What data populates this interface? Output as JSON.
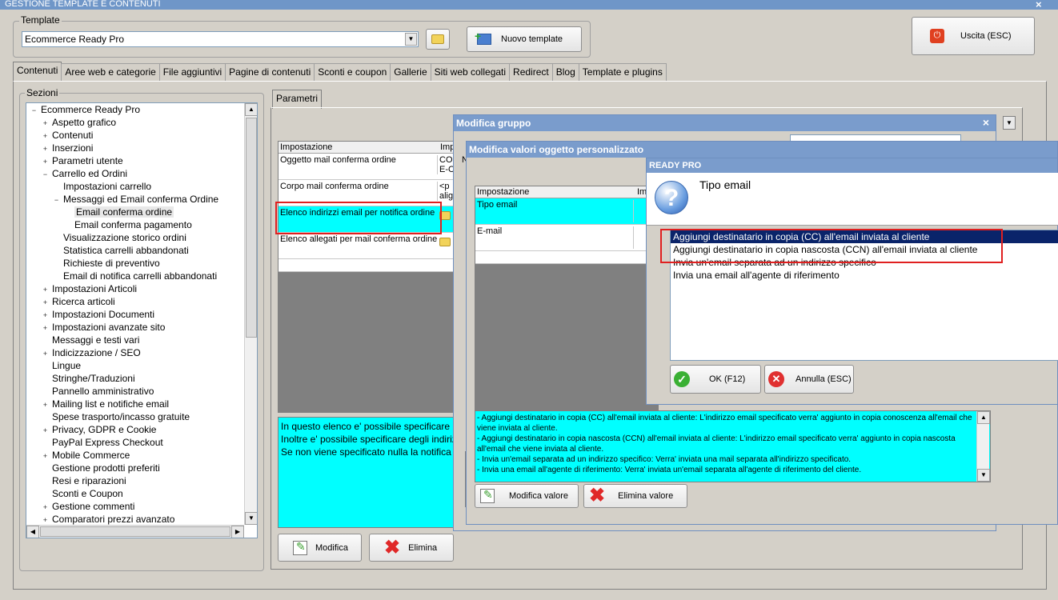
{
  "window": {
    "title": "GESTIONE TEMPLATE E CONTENUTI",
    "close": "×"
  },
  "template_group": {
    "label": "Template",
    "selected": "Ecommerce Ready Pro",
    "new_button": "Nuovo template"
  },
  "exit_button": "Uscita (ESC)",
  "tabs": [
    {
      "label": "Contenuti"
    },
    {
      "label": "Aree web e categorie"
    },
    {
      "label": "File aggiuntivi"
    },
    {
      "label": "Pagine di contenuti"
    },
    {
      "label": "Sconti e coupon"
    },
    {
      "label": "Gallerie"
    },
    {
      "label": "Siti web collegati"
    },
    {
      "label": "Redirect"
    },
    {
      "label": "Blog"
    },
    {
      "label": "Template e plugins"
    }
  ],
  "sections": {
    "label": "Sezioni",
    "tree": [
      {
        "label": "Ecommerce Ready Pro",
        "level": 0,
        "exp": "−"
      },
      {
        "label": "Aspetto grafico",
        "level": 1,
        "exp": "+"
      },
      {
        "label": "Contenuti",
        "level": 1,
        "exp": "+"
      },
      {
        "label": "Inserzioni",
        "level": 1,
        "exp": "+"
      },
      {
        "label": "Parametri utente",
        "level": 1,
        "exp": "+"
      },
      {
        "label": "Carrello ed Ordini",
        "level": 1,
        "exp": "−"
      },
      {
        "label": "Impostazioni carrello",
        "level": 2,
        "exp": ""
      },
      {
        "label": "Messaggi ed Email conferma Ordine",
        "level": 2,
        "exp": "−"
      },
      {
        "label": "Email conferma ordine",
        "level": 3,
        "exp": "",
        "selected": true
      },
      {
        "label": "Email conferma pagamento",
        "level": 3,
        "exp": ""
      },
      {
        "label": "Visualizzazione storico ordini",
        "level": 2,
        "exp": ""
      },
      {
        "label": "Statistica carrelli abbandonati",
        "level": 2,
        "exp": ""
      },
      {
        "label": "Richieste di preventivo",
        "level": 2,
        "exp": ""
      },
      {
        "label": "Email di notifica carrelli abbandonati",
        "level": 2,
        "exp": ""
      },
      {
        "label": "Impostazioni Articoli",
        "level": 1,
        "exp": "+"
      },
      {
        "label": "Ricerca articoli",
        "level": 1,
        "exp": "+"
      },
      {
        "label": "Impostazioni Documenti",
        "level": 1,
        "exp": "+"
      },
      {
        "label": "Impostazioni avanzate sito",
        "level": 1,
        "exp": "+"
      },
      {
        "label": "Messaggi e testi vari",
        "level": 1,
        "exp": ""
      },
      {
        "label": "Indicizzazione / SEO",
        "level": 1,
        "exp": "+"
      },
      {
        "label": "Lingue",
        "level": 1,
        "exp": ""
      },
      {
        "label": "Stringhe/Traduzioni",
        "level": 1,
        "exp": ""
      },
      {
        "label": "Pannello amministrativo",
        "level": 1,
        "exp": ""
      },
      {
        "label": "Mailing list e notifiche email",
        "level": 1,
        "exp": "+"
      },
      {
        "label": "Spese trasporto/incasso gratuite",
        "level": 1,
        "exp": ""
      },
      {
        "label": "Privacy, GDPR e Cookie",
        "level": 1,
        "exp": "+"
      },
      {
        "label": "PayPal Express Checkout",
        "level": 1,
        "exp": ""
      },
      {
        "label": "Mobile Commerce",
        "level": 1,
        "exp": "+"
      },
      {
        "label": "Gestione prodotti preferiti",
        "level": 1,
        "exp": ""
      },
      {
        "label": "Resi e riparazioni",
        "level": 1,
        "exp": ""
      },
      {
        "label": "Sconti e Coupon",
        "level": 1,
        "exp": ""
      },
      {
        "label": "Gestione commenti",
        "level": 1,
        "exp": "+"
      },
      {
        "label": "Comparatori prezzi avanzato",
        "level": 1,
        "exp": "+"
      }
    ]
  },
  "params": {
    "tab": "Parametri",
    "col_setting": "Impostazione",
    "col_value": "Imp",
    "rows": [
      {
        "setting": "Oggetto mail conferma ordine",
        "value": "CO\nE-C"
      },
      {
        "setting": "Corpo mail conferma ordine",
        "value": "<p\nalig"
      },
      {
        "setting": "Elenco indirizzi email per notifica ordine",
        "value": ""
      },
      {
        "setting": "Elenco allegati per mail conferma ordine",
        "value": ""
      }
    ],
    "description": "In questo elenco e' possibile specificare\nInoltre e' possibile specificare degli indiriz\nSe non viene specificato nulla la notifica",
    "edit_button": "Modifica",
    "delete_button": "Elimina"
  },
  "group_dialog": {
    "title": "Modifica gruppo",
    "close": "×",
    "col_n": "N"
  },
  "custom_dialog": {
    "title": "Modifica valori oggetto personalizzato",
    "col_setting": "Impostazione",
    "col_value": "Im",
    "rows": [
      {
        "setting": "Tipo email"
      },
      {
        "setting": "E-mail"
      }
    ],
    "description": "- Aggiungi destinatario in copia (CC) all'email inviata al cliente: L'indirizzo email specificato verra' aggiunto in copia conoscenza all'email che viene inviata al cliente.\n- Aggiungi destinatario in copia nascosta (CCN) all'email inviata al cliente: L'indirizzo email specificato verra' aggiunto in copia nascosta all'email che viene inviata al cliente.\n- Invia un'email separata ad un indirizzo specifico: Verra' inviata una mail separata all'indirizzo specificato.\n- Invia una email all'agente di riferimento: Verra' inviata un'email separata all'agente di riferimento del cliente.",
    "edit_button": "Modifica valore",
    "delete_button": "Elimina valore"
  },
  "choice_dialog": {
    "title": "READY PRO",
    "question_icon": "?",
    "heading": "Tipo email",
    "options": [
      "Aggiungi destinatario in copia (CC) all'email inviata al cliente",
      "Aggiungi destinatario in copia nascosta (CCN) all'email inviata al cliente",
      "Invia un'email separata ad un indirizzo specifico",
      "Invia una email all'agente di riferimento"
    ],
    "ok_button": "OK (F12)",
    "cancel_button": "Annulla (ESC)"
  },
  "colors": {
    "title_blue": "#6f96c8",
    "selection": "#0a246a",
    "cyan": "#00ffff",
    "highlight_red": "#e02020"
  }
}
